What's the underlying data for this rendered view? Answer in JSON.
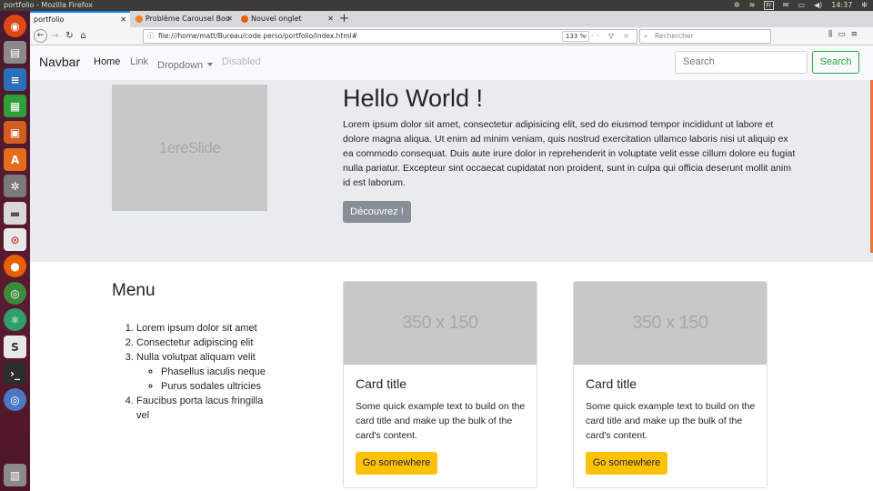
{
  "os": {
    "window_title": "portfolio - Mozilla Firefox",
    "keyboard_layout": "Fr",
    "clock": "14:37"
  },
  "browser": {
    "tabs": [
      {
        "label": "portfolio",
        "active": true
      },
      {
        "label": "Problème Carousel Boo",
        "active": false
      },
      {
        "label": "Nouvel onglet",
        "active": false
      }
    ],
    "url": "file:///home/matt/Bureau/code perso/portfolio/index.html#",
    "zoom": "133 %",
    "search_placeholder": "Rechercher"
  },
  "site": {
    "navbar": {
      "brand": "Navbar",
      "links": [
        "Home",
        "Link",
        "Dropdown",
        "Disabled"
      ],
      "search_placeholder": "Search",
      "search_button": "Search"
    },
    "hero": {
      "slide_text": "1ereSlide",
      "heading": "Hello World !",
      "paragraph": "Lorem ipsum dolor sit amet, consectetur adipisicing elit, sed do eiusmod tempor incididunt ut labore et dolore magna aliqua. Ut enim ad minim veniam, quis nostrud exercitation ullamco laboris nisi ut aliquip ex ea commodo consequat. Duis aute irure dolor in reprehenderit in voluptate velit esse cillum dolore eu fugiat nulla pariatur. Excepteur sint occaecat cupidatat non proident, sunt in culpa qui officia deserunt mollit anim id est laborum.",
      "button": "Découvrez !"
    },
    "menu": {
      "title": "Menu",
      "items": [
        "Lorem ipsum dolor sit amet",
        "Consectetur adipiscing elit",
        "Nulla volutpat aliquam velit",
        "Faucibus porta lacus fringilla vel"
      ],
      "subitems": [
        "Phasellus iaculis neque",
        "Purus sodales ultricies"
      ]
    },
    "cards": [
      {
        "image_text": "350 x 150",
        "title": "Card title",
        "text": "Some quick example text to build on the card title and make up the bulk of the card's content.",
        "button": "Go somewhere"
      },
      {
        "image_text": "350 x 150",
        "title": "Card title",
        "text": "Some quick example text to build on the card title and make up the bulk of the card's content.",
        "button": "Go somewhere"
      }
    ]
  },
  "colors": {
    "success": "#28a745",
    "warning": "#ffc107",
    "secondary": "#868e96",
    "jumbotron": "#e9ecef"
  }
}
